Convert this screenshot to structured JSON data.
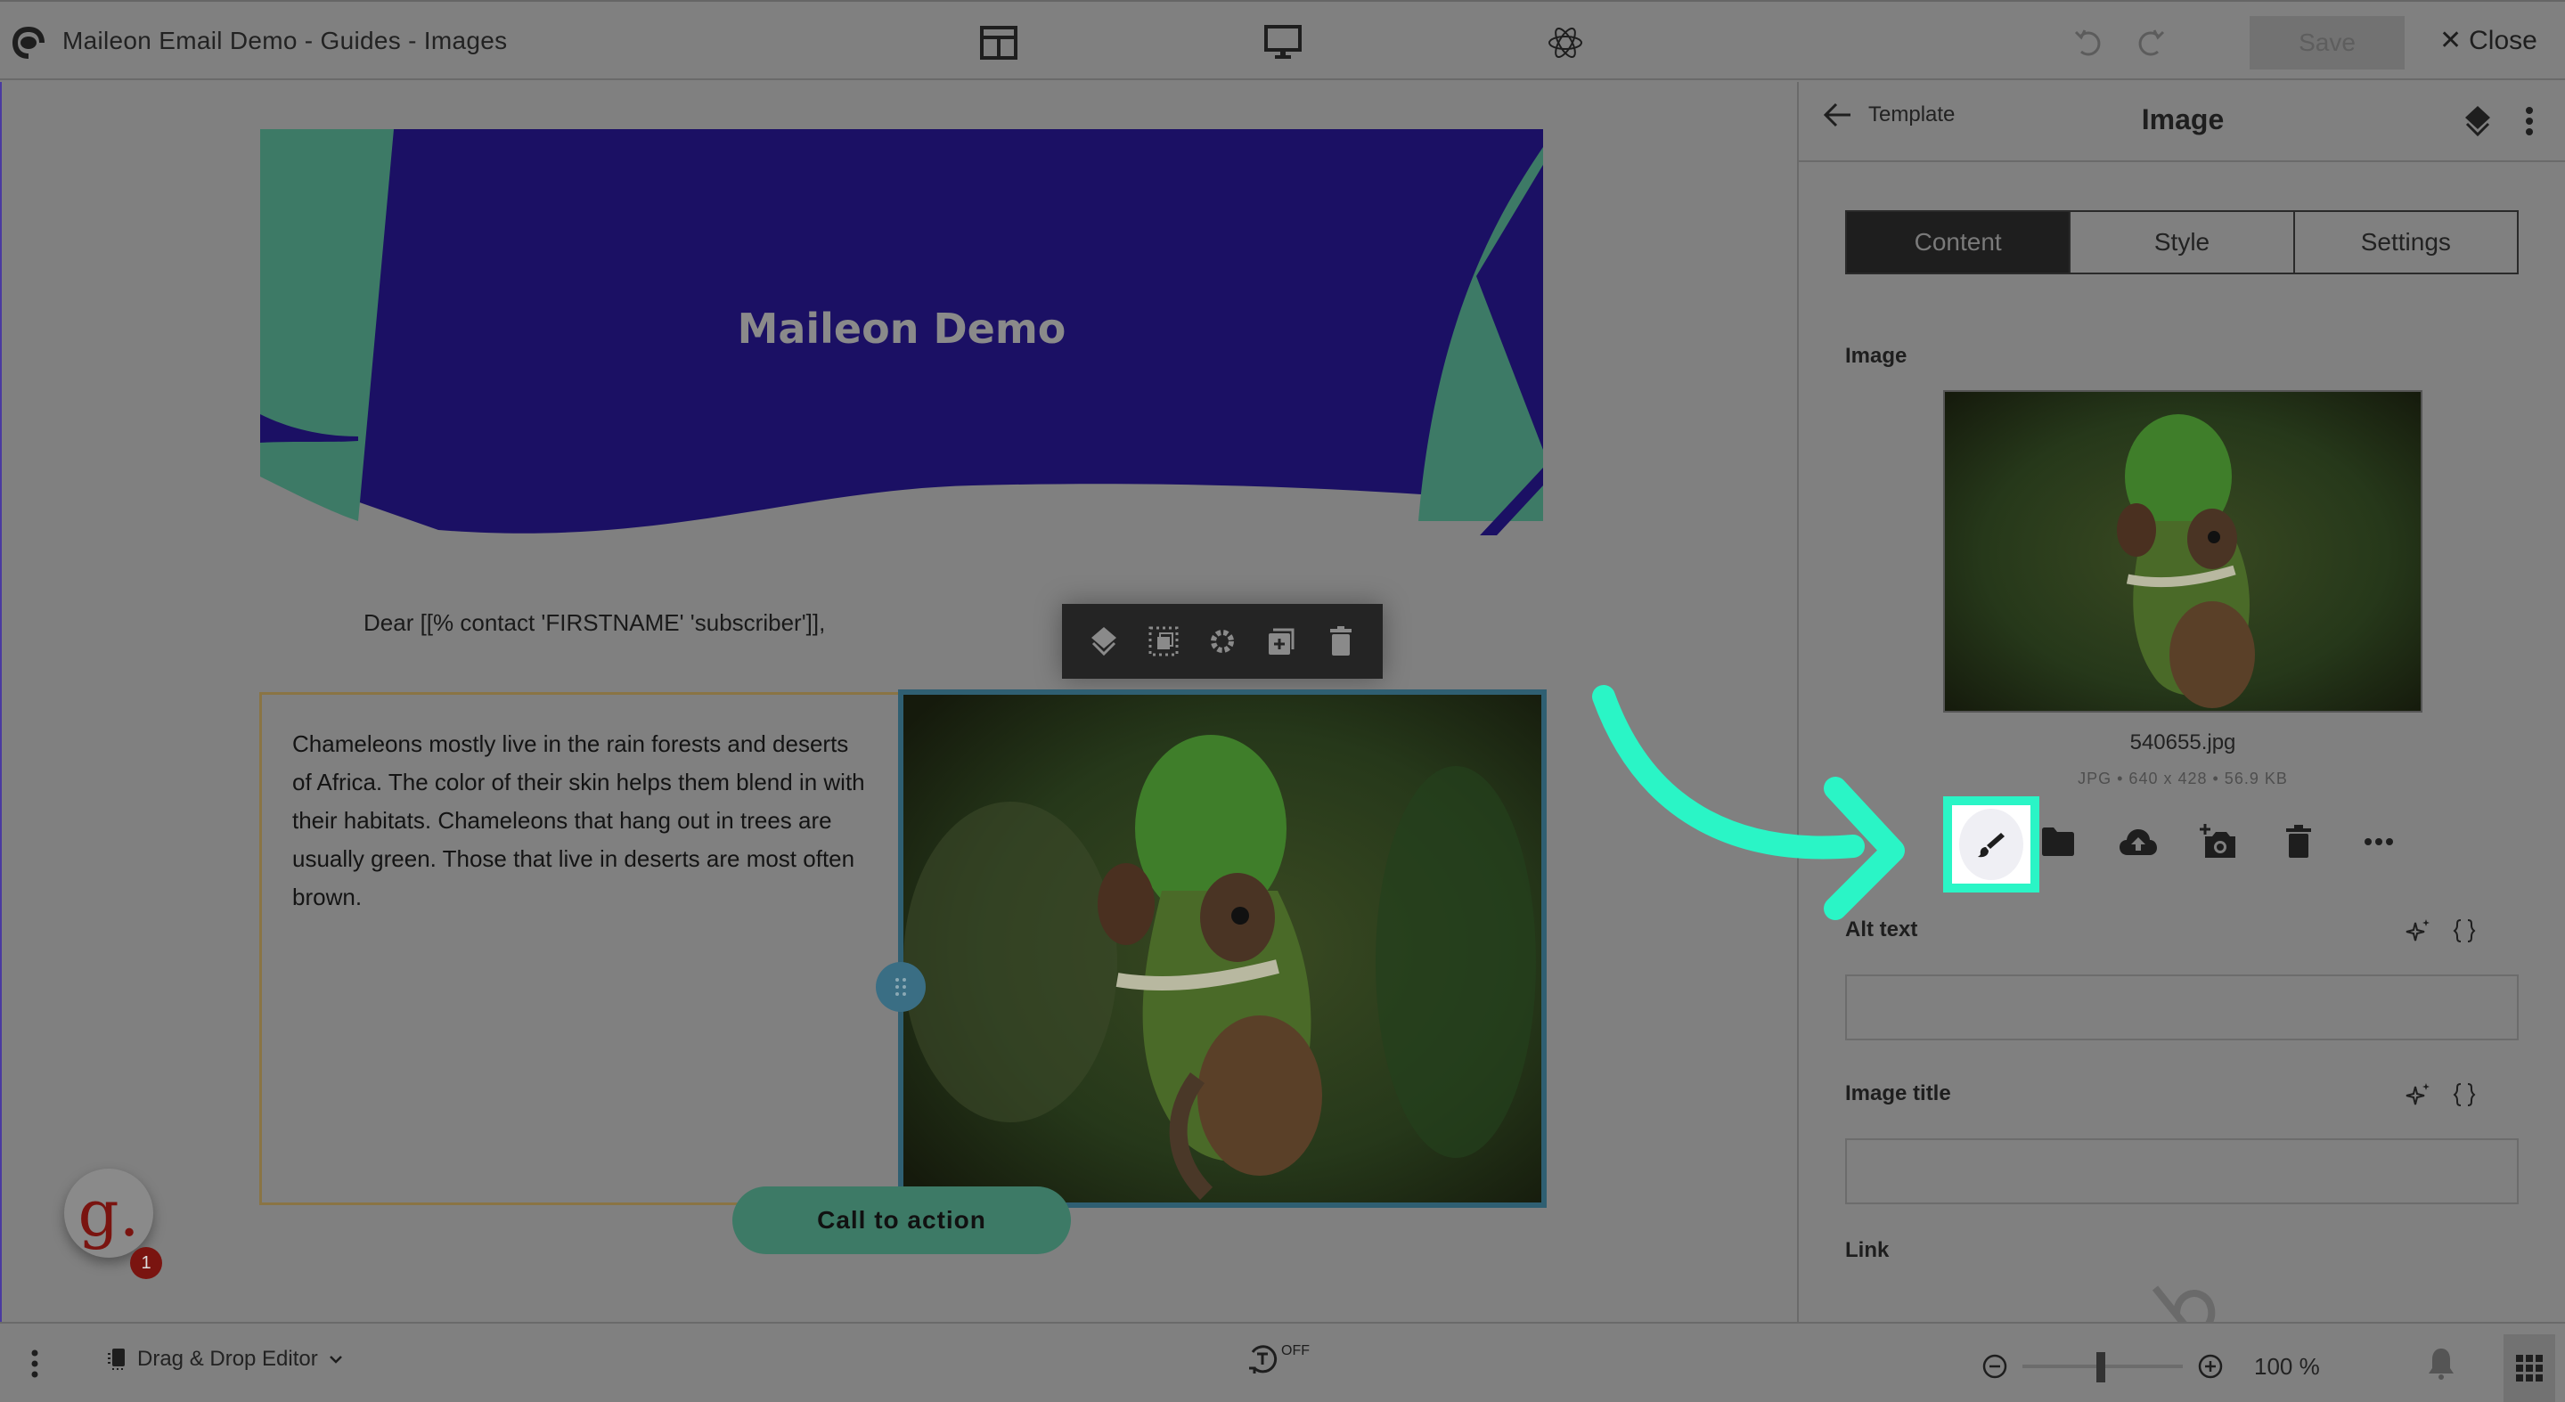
{
  "window": {
    "title": "Maileon Email Demo - Guides - Images",
    "save_label": "Save",
    "close_label": "Close",
    "toolbar_icons": [
      "layout-icon",
      "desktop-preview-icon",
      "atom-icon",
      "undo-icon",
      "redo-icon"
    ]
  },
  "canvas": {
    "banner_title": "Maileon Demo",
    "greeting": "Dear [[% contact 'FIRSTNAME' 'subscriber']],",
    "body_text": "Chameleons mostly live in the rain forests and deserts of Africa. The color of their skin helps them blend in with their habitats. Chameleons that hang out in trees are usually green. Those that live in deserts are most often brown.",
    "cta_label": "Call to action",
    "block_toolbar": [
      "layers-icon",
      "select-parent-icon",
      "settings-icon",
      "duplicate-icon",
      "delete-icon"
    ],
    "notification_badge_letter": "g.",
    "notification_count": "1"
  },
  "panel": {
    "back_label": "Template",
    "title": "Image",
    "tabs": [
      {
        "label": "Content",
        "active": true
      },
      {
        "label": "Style",
        "active": false
      },
      {
        "label": "Settings",
        "active": false
      }
    ],
    "image_section_label": "Image",
    "file_name": "540655.jpg",
    "file_meta": "JPG • 640  x  428 • 56.9 KB",
    "image_actions": [
      "edit-brush-icon",
      "folder-icon",
      "cloud-upload-icon",
      "add-photo-icon",
      "trash-icon",
      "more-icon"
    ],
    "alt_text_label": "Alt text",
    "alt_text_value": "",
    "image_title_label": "Image title",
    "image_title_value": "",
    "link_label": "Link"
  },
  "bottombar": {
    "editor_mode": "Drag & Drop Editor",
    "autosave_state": "OFF",
    "zoom_value": "100 %",
    "zoom_level_percent": 100
  },
  "colors": {
    "highlight": "#2af5c6",
    "banner_bg": "#1b1064",
    "banner_leaf": "#3d7a66",
    "cta_bg": "#3d7a66",
    "selection": "#2f5f72"
  }
}
